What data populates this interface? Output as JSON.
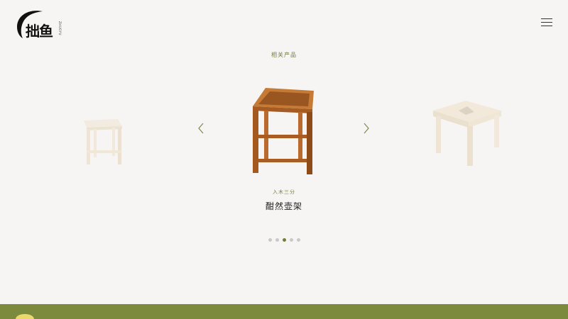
{
  "brand": {
    "logo_text": "拙鱼",
    "logo_sub": "ZHUOYU"
  },
  "header": {
    "menu_icon": "menu-icon"
  },
  "section": {
    "title": "相关产品"
  },
  "carousel": {
    "prev_icon": "chevron-left-icon",
    "next_icon": "chevron-right-icon",
    "current_subtitle": "入木三分",
    "current_name": "酣然壶架",
    "slide_count": 5,
    "active_index": 2
  },
  "colors": {
    "accent": "#6f7f3a",
    "background": "#f7f5f3",
    "footer": "#7b8a3c",
    "wood": "#b4662a"
  }
}
